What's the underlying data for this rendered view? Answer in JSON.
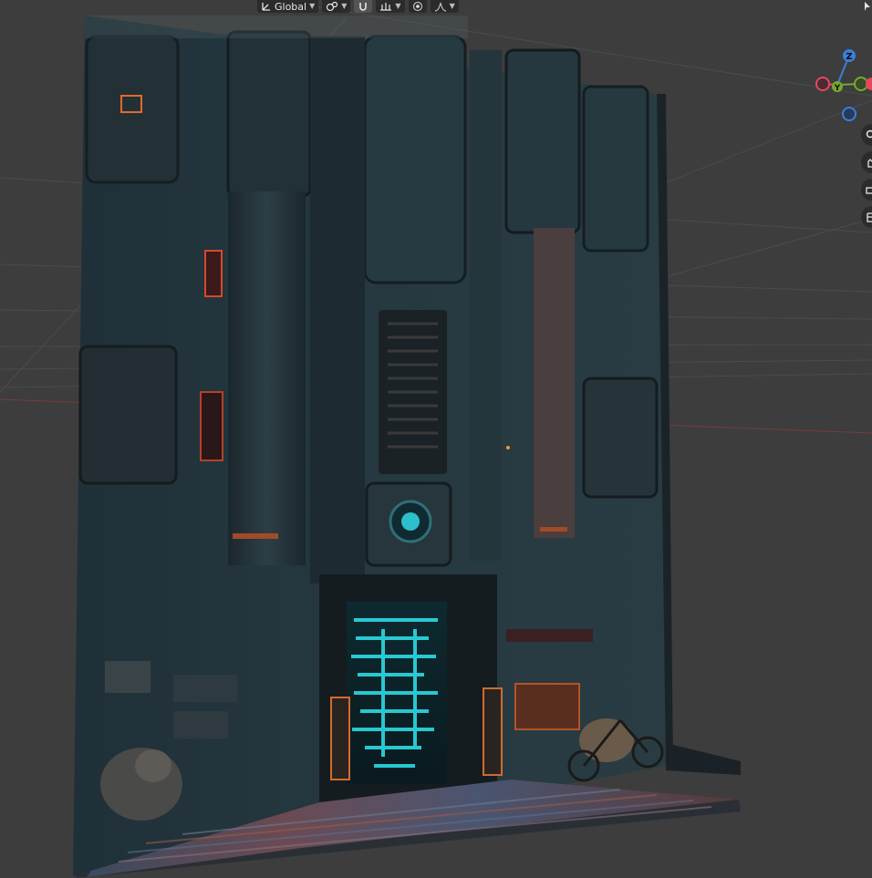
{
  "toolbar": {
    "transform_orientation": {
      "label": "Global",
      "icon": "global-orientation-icon"
    },
    "pivot": {
      "icon": "pivot-point-icon"
    },
    "snap": {
      "icon": "snap-magnet-icon",
      "active": true
    },
    "snap_target": {
      "icon": "snap-increment-icon"
    },
    "proportional": {
      "icon": "proportional-editing-icon"
    },
    "falloff": {
      "icon": "falloff-curve-icon"
    }
  },
  "gizmo": {
    "z_label": "Z",
    "y_label": "Y",
    "colors": {
      "x": "#e8465e",
      "y": "#76a82b",
      "z": "#3b7fd6"
    }
  },
  "side_tools": [
    {
      "icon": "zoom-magnifier-icon"
    },
    {
      "icon": "pan-hand-icon"
    },
    {
      "icon": "camera-view-icon"
    },
    {
      "icon": "perspective-grid-icon"
    }
  ],
  "scene": {
    "plane_texture": "cyberpunk-building-facade",
    "neon_door_color": "#2ee6f0",
    "accent_orange": "#e36a2a",
    "origin_color": "#f29a1f"
  }
}
